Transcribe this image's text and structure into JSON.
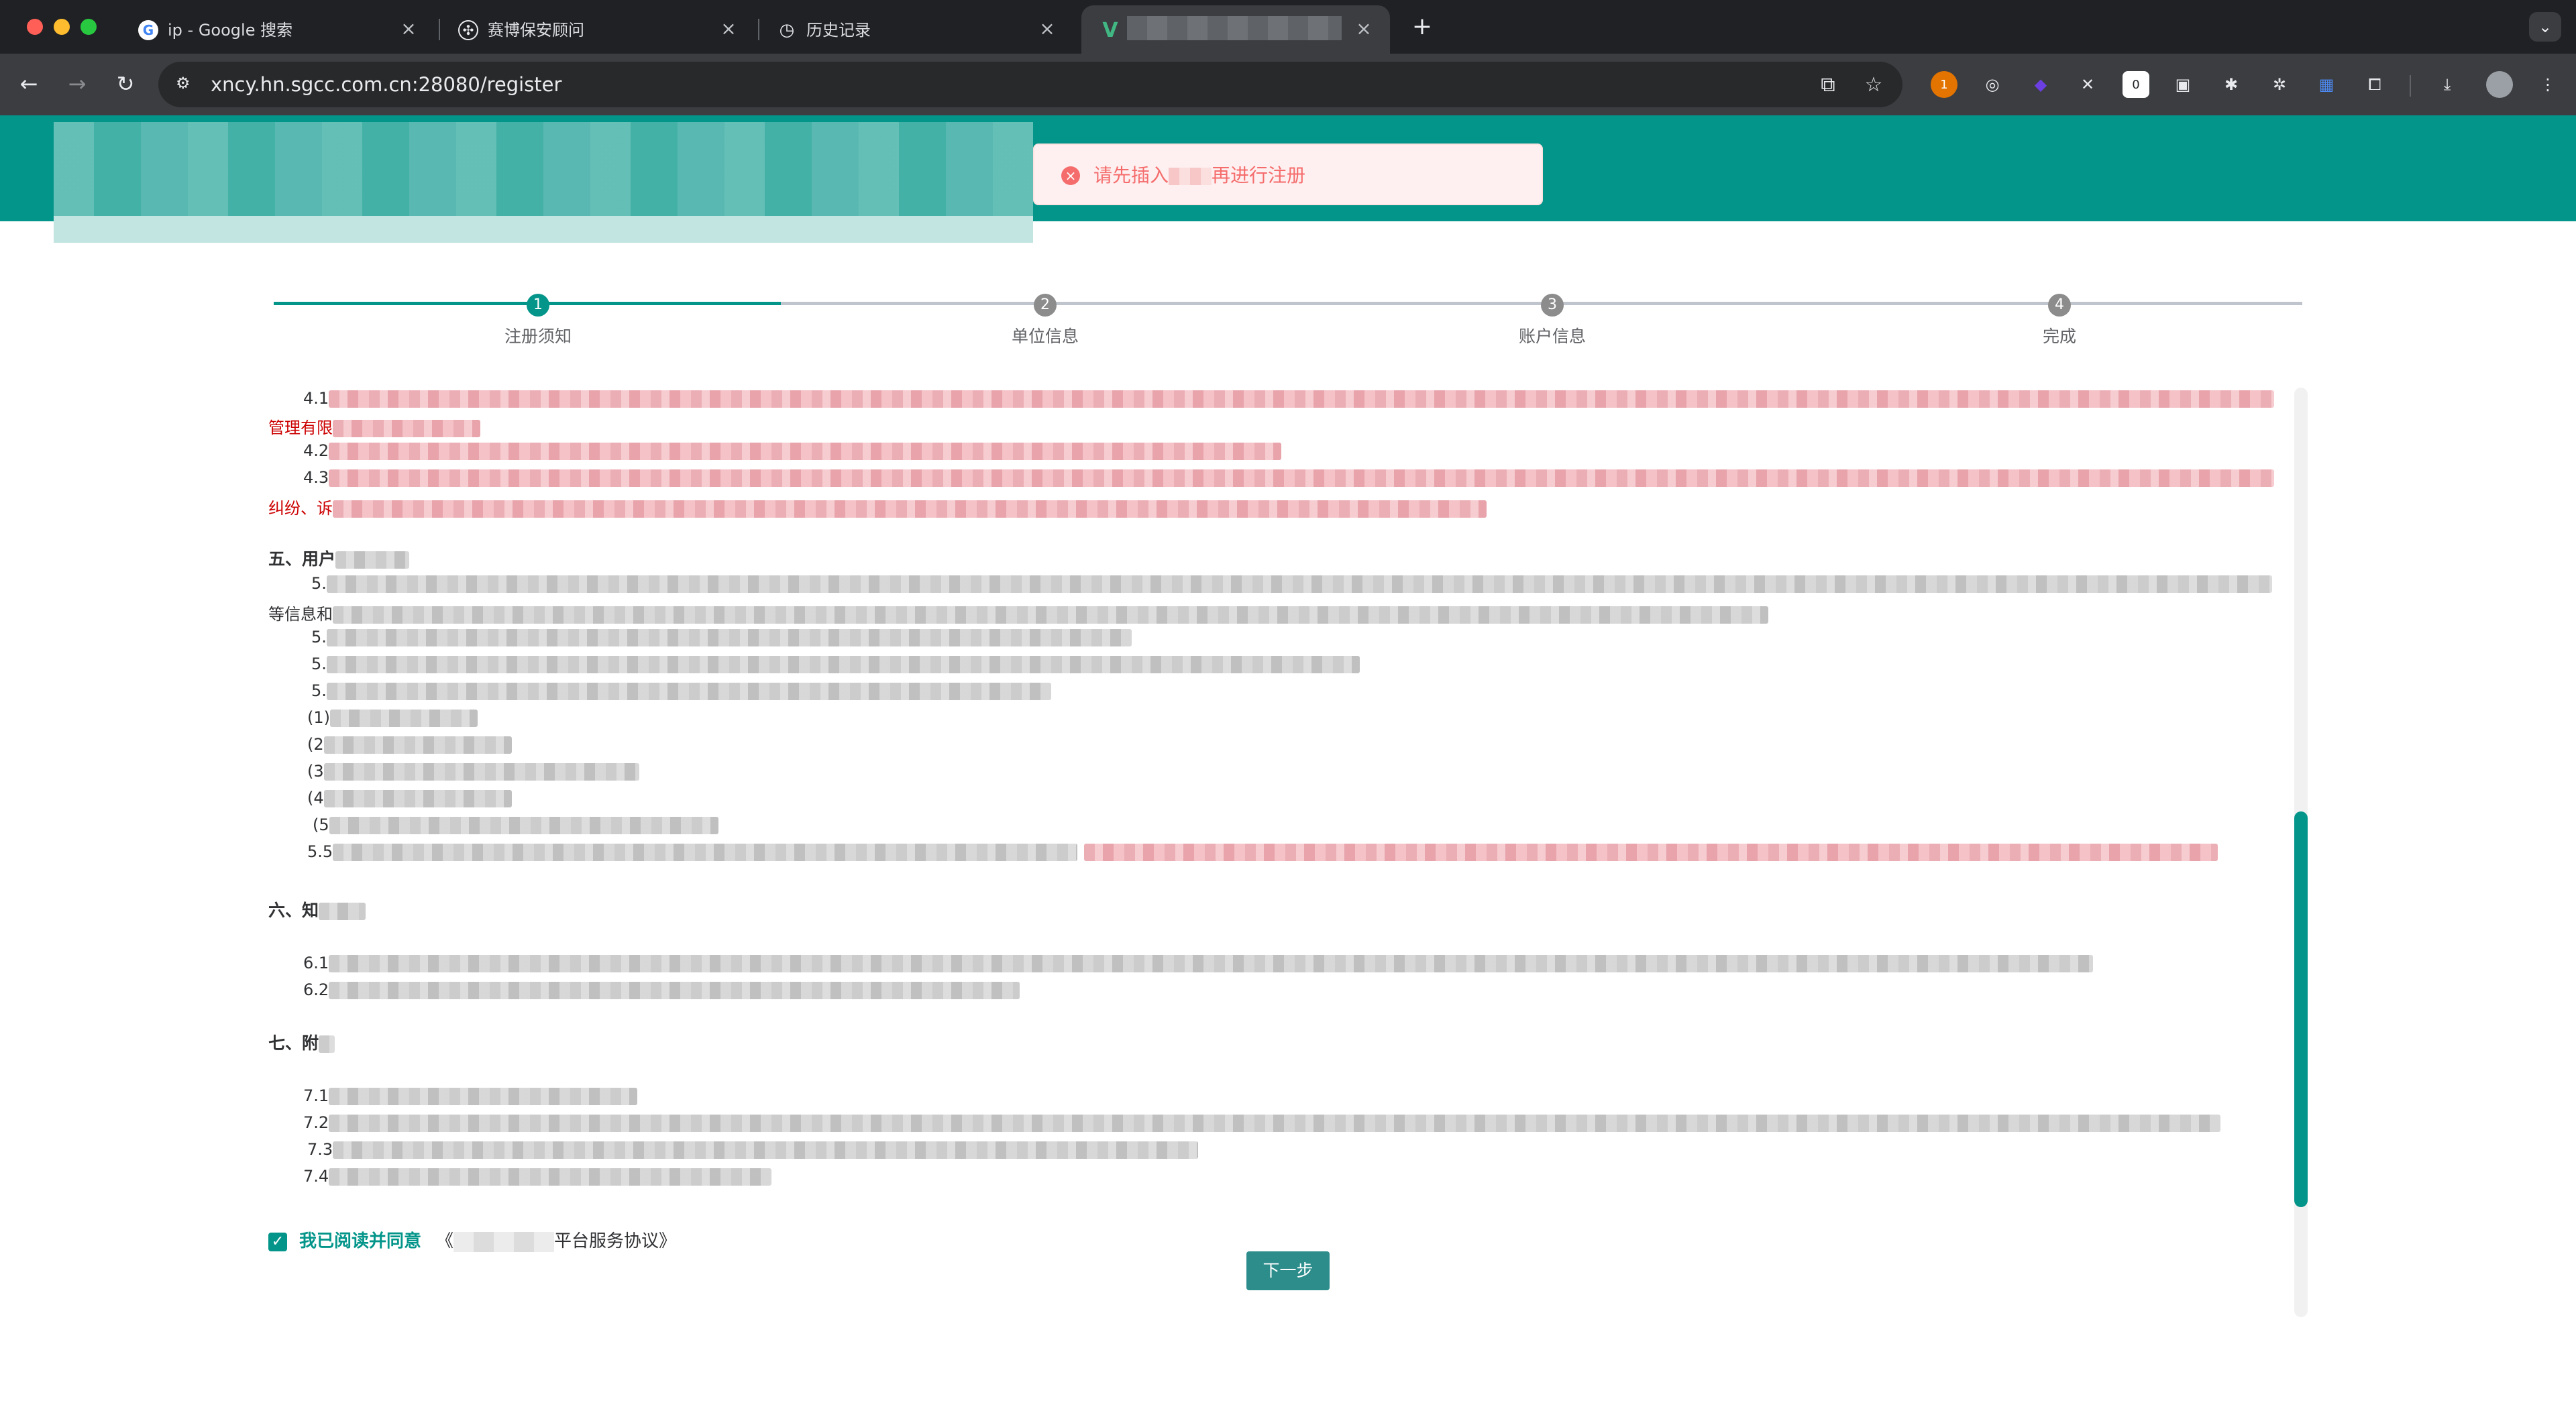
{
  "browser": {
    "tabs": [
      {
        "favicon": "google-icon",
        "title": "ip - Google 搜索"
      },
      {
        "favicon": "openai-icon",
        "title": "赛博保安顾问"
      },
      {
        "favicon": "history-icon",
        "title": "历史记录"
      },
      {
        "favicon": "vue-icon",
        "title": ""
      }
    ],
    "new_tab_label": "+",
    "url": "xncy.hn.sgcc.com.cn:28080/register",
    "ext_badge_count": "1",
    "ext_badge_count_2": "0"
  },
  "toast": {
    "message": "请先插入▒▒再进行注册",
    "prefix": "请先插入",
    "suffix": "再进行注册"
  },
  "steps": [
    {
      "number": "1",
      "label": "注册须知"
    },
    {
      "number": "2",
      "label": "单位信息"
    },
    {
      "number": "3",
      "label": "账户信息"
    },
    {
      "number": "4",
      "label": "完成"
    }
  ],
  "agreement": {
    "l41": "4.1",
    "l41b": "管理有限",
    "l42": "4.2",
    "l43": "4.3",
    "l43b": "纠纷、诉",
    "sec5": "五、用户",
    "l51": "5.",
    "l51b": "等信息和",
    "l52": "5.",
    "l53": "5.",
    "l54": "5.",
    "i1": "(1)",
    "i2": "(2",
    "i3": "(3",
    "i4": "(4",
    "i5": "(5",
    "l55": "5.5",
    "sec6": "六、知",
    "l61": "6.1",
    "l62": "6.2",
    "sec7": "七、附",
    "l71": "7.1",
    "l72": "7.2",
    "l73": "7.3",
    "l74": "7.4"
  },
  "consent": {
    "label": "我已阅读并同意",
    "link_prefix": "《",
    "link_suffix": "平台服务协议》"
  },
  "next_button": "下一步",
  "colors": {
    "brand": "#03958a",
    "error": "#f56c6c",
    "chrome_bg": "#202124"
  }
}
